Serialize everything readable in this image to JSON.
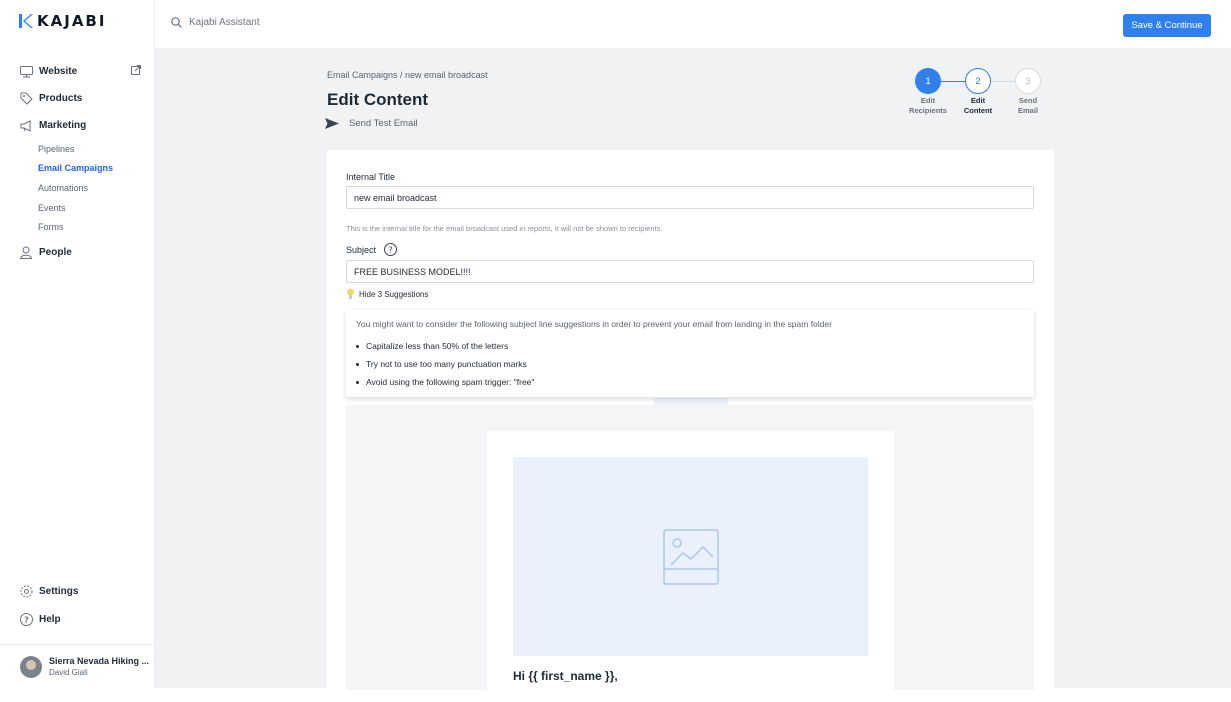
{
  "brand": {
    "name": "KAJABI",
    "accent": "#2f80ed",
    "active_link": "#2563eb"
  },
  "search": {
    "placeholder": "Kajabi Assistant"
  },
  "topbar": {
    "save_label": "Save & Continue"
  },
  "sidebar": {
    "items": [
      {
        "label": "Website",
        "icon": "monitor-icon"
      },
      {
        "label": "Products",
        "icon": "tag-icon"
      },
      {
        "label": "Marketing",
        "icon": "megaphone-icon"
      },
      {
        "label": "People",
        "icon": "person-icon"
      }
    ],
    "marketing_sub": [
      {
        "label": "Pipelines"
      },
      {
        "label": "Email Campaigns"
      },
      {
        "label": "Automations"
      },
      {
        "label": "Events"
      },
      {
        "label": "Forms"
      }
    ],
    "bottom": [
      {
        "label": "Settings",
        "icon": "gear-icon"
      },
      {
        "label": "Help",
        "icon": "help-circle-icon"
      }
    ],
    "user": {
      "site": "Sierra Nevada Hiking ...",
      "name": "David Giali"
    }
  },
  "page": {
    "breadcrumb": "Email Campaigns  /  new email broadcast",
    "title": "Edit Content",
    "send_test": "Send Test Email"
  },
  "stepper": {
    "steps": [
      {
        "number": "1",
        "line1": "Edit",
        "line2": "Recipients",
        "state": "complete"
      },
      {
        "number": "2",
        "line1": "Edit",
        "line2": "Content",
        "state": "current"
      },
      {
        "number": "3",
        "line1": "Send",
        "line2": "Email",
        "state": "upcoming"
      }
    ]
  },
  "form": {
    "internal_title_label": "Internal Title",
    "internal_title_value": "new email broadcast",
    "internal_title_help": "This is the internal title for the email broadcast used in reports, it will not be shown to recipients.",
    "subject_label": "Subject",
    "subject_value": "FREE BUSINESS MODEL!!!!",
    "suggestions_toggle": "Hide 3 Suggestions",
    "suggestions_intro": "You might want to consider the following subject line suggestions in order to prevent your email from landing in the spam folder",
    "suggestions": [
      "Capitalize less than 50% of the letters",
      "Try not to use too many punctuation marks",
      "Avoid using the following spam trigger: \"free\""
    ]
  },
  "email_preview": {
    "greeting": "Hi {{ first_name }},"
  }
}
